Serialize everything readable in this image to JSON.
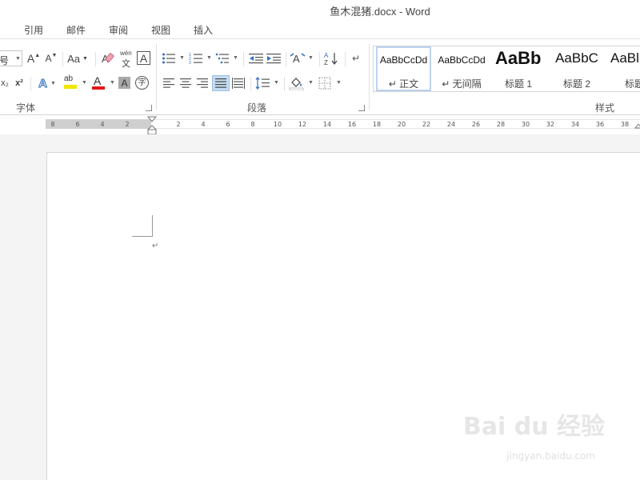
{
  "window": {
    "title": "鱼木混猪.docx - Word"
  },
  "tabs": [
    {
      "label": "引用"
    },
    {
      "label": "邮件"
    },
    {
      "label": "审阅"
    },
    {
      "label": "视图"
    },
    {
      "label": "插入"
    }
  ],
  "font_group": {
    "label": "字体",
    "font_size_fragment": "号",
    "change_case_label": "Aa",
    "grow_font_label": "A",
    "shrink_font_label": "A",
    "phonetic_top": "wén",
    "phonetic_bottom": "文",
    "char_border_label": "A",
    "subscript_label": "x₂",
    "superscript_label": "x²",
    "text_effect_label": "A",
    "highlight_label": "ab",
    "font_color_label": "A",
    "char_shading_label": "A",
    "enclose_label": "字",
    "highlight_color": "#f2e600",
    "font_color": "#e11919"
  },
  "paragraph_group": {
    "label": "段落"
  },
  "styles_group": {
    "label": "样式",
    "items": [
      {
        "preview": "AaBbCcDd",
        "name": "↵ 正文"
      },
      {
        "preview": "AaBbCcDd",
        "name": "↵ 无间隔"
      },
      {
        "preview": "AaBb",
        "name": "标题 1"
      },
      {
        "preview": "AaBbC",
        "name": "标题 2"
      },
      {
        "preview": "AaBl",
        "name": "标题"
      }
    ]
  },
  "ruler": {
    "left_numbers": [
      "8",
      "6",
      "4",
      "2"
    ],
    "right_numbers": [
      "2",
      "4",
      "6",
      "8",
      "10",
      "12",
      "14",
      "16",
      "18",
      "20",
      "22",
      "24",
      "26",
      "28",
      "30",
      "32",
      "34",
      "36",
      "38"
    ]
  },
  "document": {
    "paragraph_mark": "↵"
  },
  "watermark": {
    "main": "Bai du 经验",
    "sub": "jingyan.baidu.com"
  }
}
